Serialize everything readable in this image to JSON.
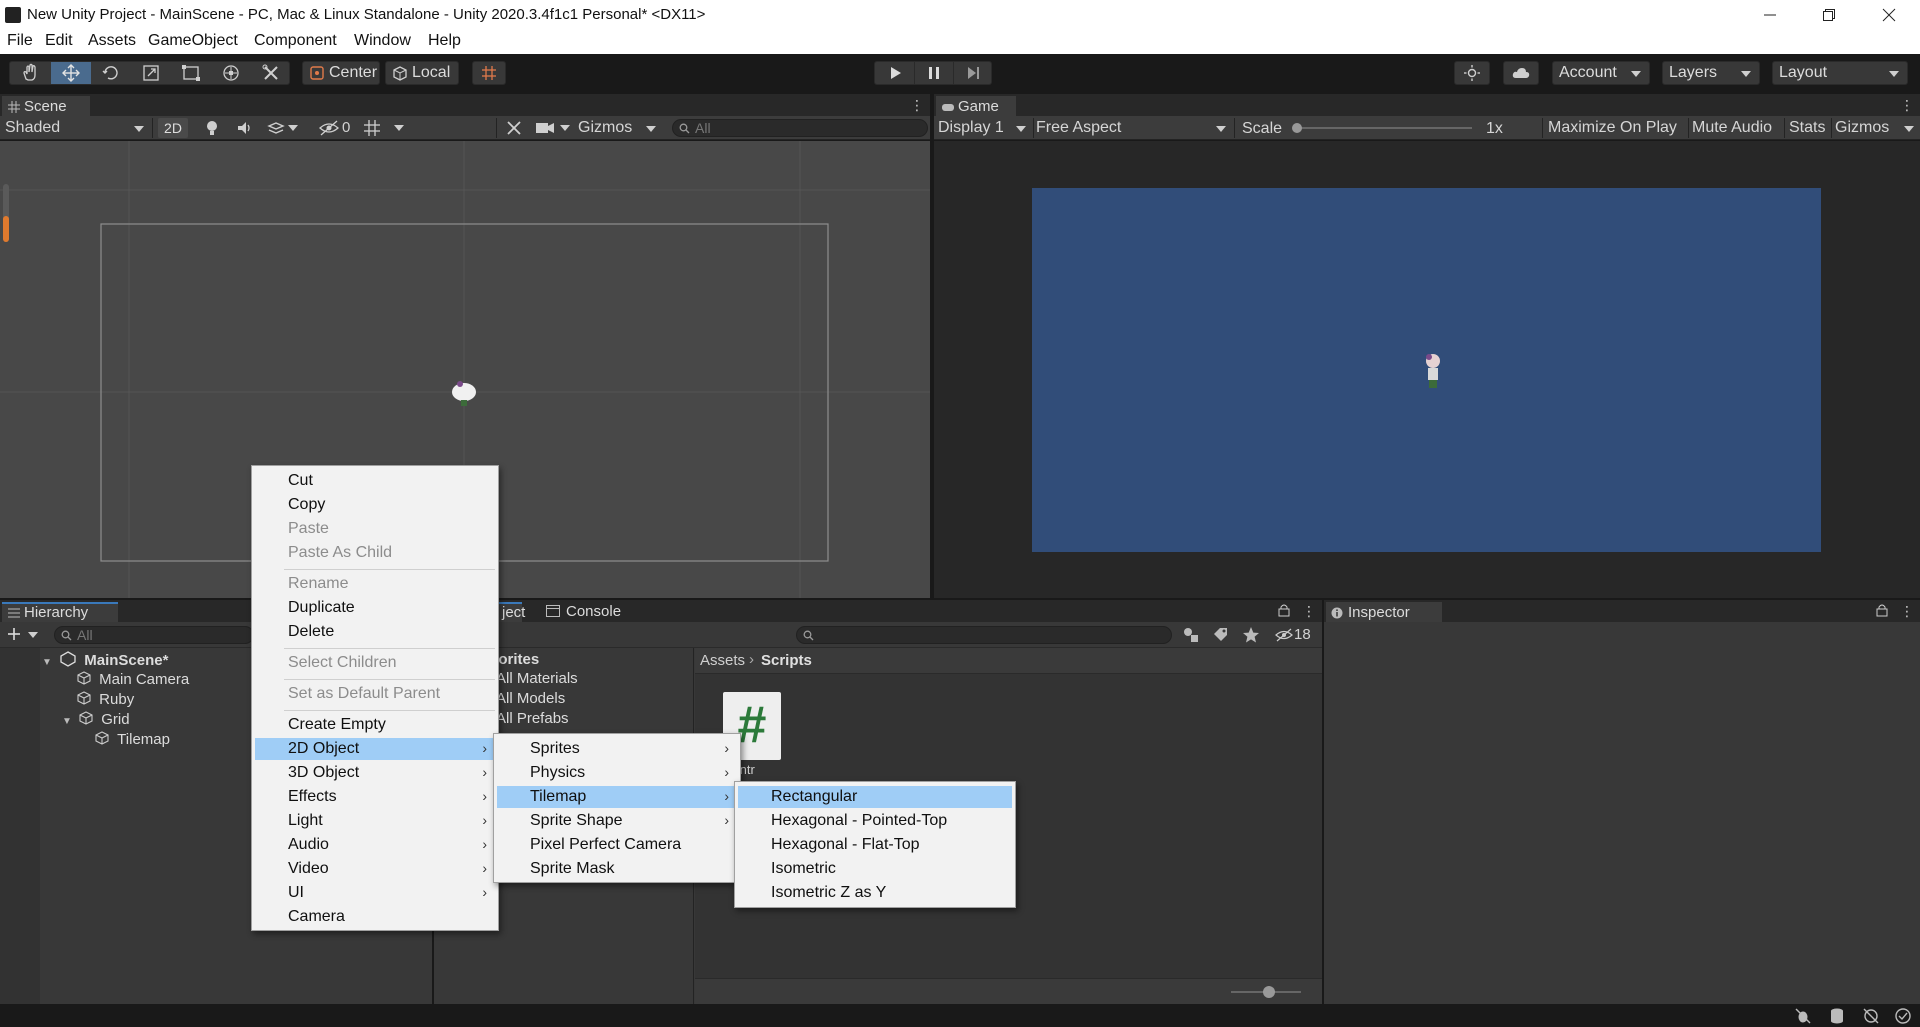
{
  "window": {
    "title": "New Unity Project - MainScene - PC, Mac & Linux Standalone - Unity 2020.3.4f1c1 Personal* <DX11>"
  },
  "menubar": [
    "File",
    "Edit",
    "Assets",
    "GameObject",
    "Component",
    "Window",
    "Help"
  ],
  "toolbar": {
    "pivot_label": "Center",
    "space_label": "Local",
    "account_label": "Account",
    "layers_label": "Layers",
    "layout_label": "Layout"
  },
  "scene": {
    "tab_label": "Scene",
    "shading_mode": "Shaded",
    "mode_2d_label": "2D",
    "hidden_count": "0",
    "gizmos_label": "Gizmos",
    "search_placeholder": "All"
  },
  "game": {
    "tab_label": "Game",
    "display_label": "Display 1",
    "aspect_label": "Free Aspect",
    "scale_label": "Scale",
    "scale_value": "1x",
    "maximize_label": "Maximize On Play",
    "mute_label": "Mute Audio",
    "stats_label": "Stats",
    "gizmos_label": "Gizmos",
    "background_color": "#314d79"
  },
  "hierarchy": {
    "tab_label": "Hierarchy",
    "search_placeholder": "All",
    "scene_name": "MainScene*",
    "items": [
      "Main Camera",
      "Ruby",
      "Grid",
      "Tilemap"
    ]
  },
  "project": {
    "tab_label_partial": "ject",
    "console_tab_label": "Console",
    "hidden_count": "18",
    "favorites_label_partial": "vorites",
    "favorites": [
      "All Materials",
      "All Models",
      "All Prefabs"
    ],
    "breadcrumb": [
      "Assets",
      "Scripts"
    ],
    "asset_label_partial": "Contr",
    "asset_glyph": "#"
  },
  "inspector": {
    "tab_label": "Inspector"
  },
  "context_menu": {
    "items": [
      {
        "label": "Cut",
        "disabled": false
      },
      {
        "label": "Copy",
        "disabled": false
      },
      {
        "label": "Paste",
        "disabled": true
      },
      {
        "label": "Paste As Child",
        "disabled": true
      },
      {
        "label": "Rename",
        "disabled": true
      },
      {
        "label": "Duplicate",
        "disabled": false
      },
      {
        "label": "Delete",
        "disabled": false
      },
      {
        "label": "Select Children",
        "disabled": true
      },
      {
        "label": "Set as Default Parent",
        "disabled": true
      },
      {
        "label": "Create Empty",
        "disabled": false
      },
      {
        "label": "2D Object",
        "disabled": false
      },
      {
        "label": "3D Object",
        "disabled": false
      },
      {
        "label": "Effects",
        "disabled": false
      },
      {
        "label": "Light",
        "disabled": false
      },
      {
        "label": "Audio",
        "disabled": false
      },
      {
        "label": "Video",
        "disabled": false
      },
      {
        "label": "UI",
        "disabled": false
      },
      {
        "label": "Camera",
        "disabled": false
      }
    ],
    "highlighted": "2D Object"
  },
  "submenu_2d": {
    "items": [
      "Sprites",
      "Physics",
      "Tilemap",
      "Sprite Shape",
      "Pixel Perfect Camera",
      "Sprite Mask"
    ],
    "highlighted": "Tilemap"
  },
  "submenu_tilemap": {
    "items": [
      "Rectangular",
      "Hexagonal - Pointed-Top",
      "Hexagonal - Flat-Top",
      "Isometric",
      "Isometric Z as Y"
    ],
    "highlighted": "Rectangular"
  }
}
